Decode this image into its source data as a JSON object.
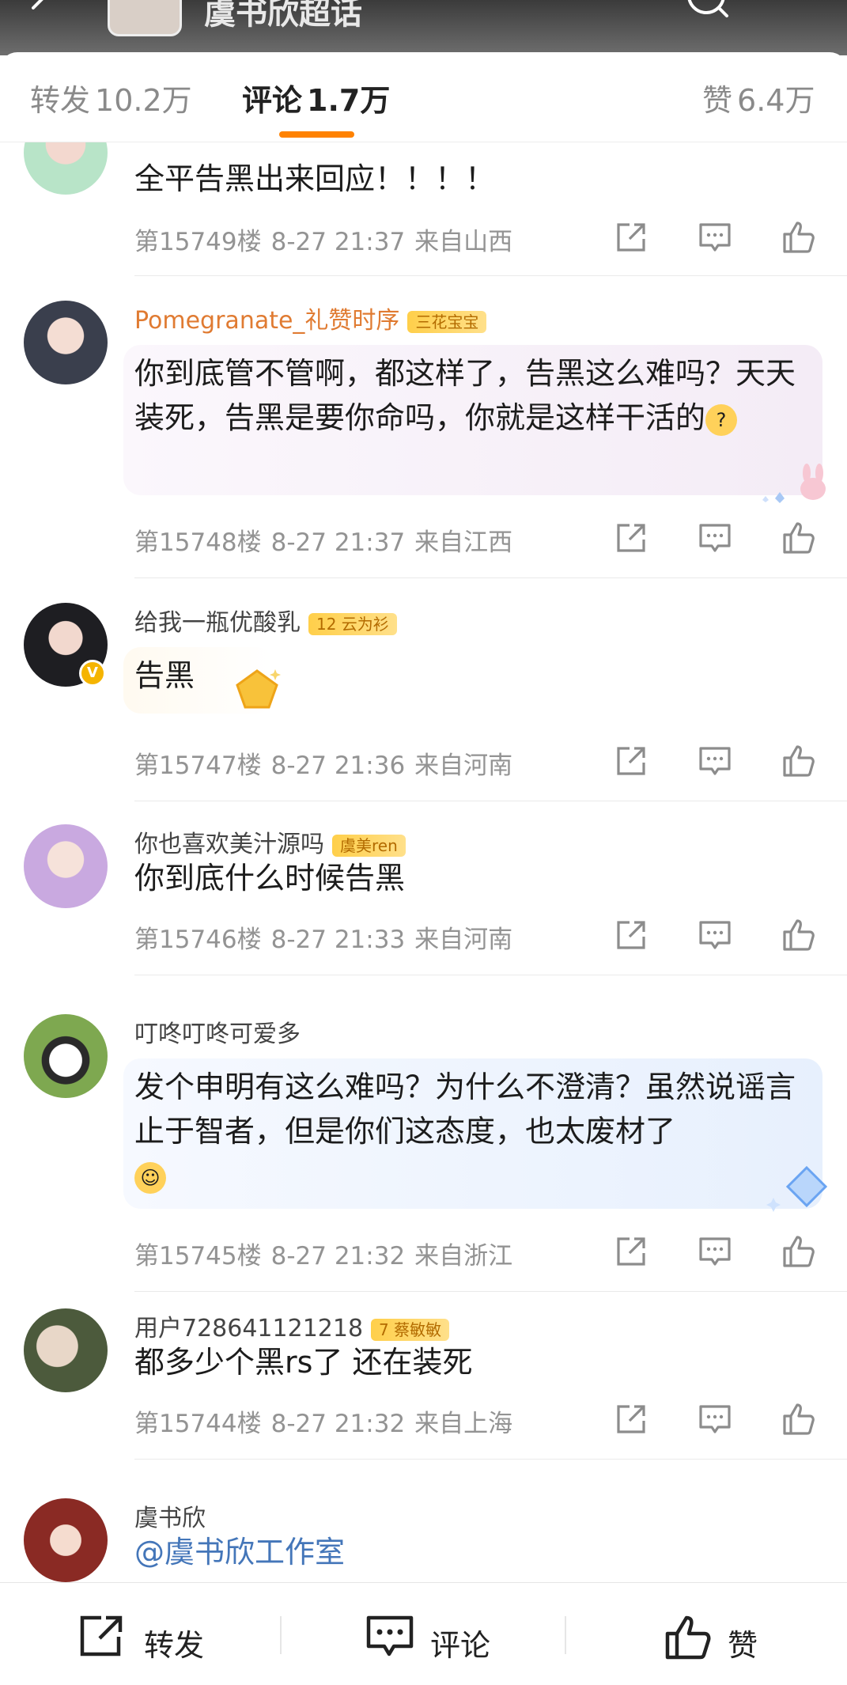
{
  "header": {
    "title": "虞书欣超话"
  },
  "tabs": [
    {
      "label": "转发",
      "count": "10.2万"
    },
    {
      "label": "评论",
      "count": "1.7万"
    },
    {
      "label": "赞",
      "count": "6.4万"
    }
  ],
  "comments": [
    {
      "username": "",
      "text": "全平告黑出来回应！！！！",
      "floor": "第15749楼",
      "time": "8-27 21:37",
      "location": "来自山西"
    },
    {
      "username": "Pomegranate_礼赞时序",
      "tag": "三花宝宝",
      "text": "你到底管不管啊，都这样了，告黑这么难吗？天天装死，告黑是要你命吗，你就是这样干活的",
      "floor": "第15748楼",
      "time": "8-27 21:37",
      "location": "来自江西"
    },
    {
      "username": "给我一瓶优酸乳",
      "tag": "12 云为衫",
      "text": "告黑",
      "floor": "第15747楼",
      "time": "8-27 21:36",
      "location": "来自河南"
    },
    {
      "username": "你也喜欢美汁源吗",
      "tag": "虞美ren",
      "text": "你到底什么时候告黑",
      "floor": "第15746楼",
      "time": "8-27 21:33",
      "location": "来自河南"
    },
    {
      "username": "叮咚叮咚可爱多",
      "tag": "",
      "text": "发个申明有这么难吗？为什么不澄清？虽然说谣言止于智者，但是你们这态度，也太废材了",
      "floor": "第15745楼",
      "time": "8-27 21:32",
      "location": "来自浙江"
    },
    {
      "username": "用户728641121218",
      "tag": "7 蔡敏敏",
      "text": "都多少个黑rs了 还在装死",
      "floor": "第15744楼",
      "time": "8-27 21:32",
      "location": "来自上海"
    },
    {
      "username": "虞书欣",
      "tag": "",
      "text": "@虞书欣工作室",
      "floor": "",
      "time": "",
      "location": ""
    }
  ],
  "bottombar": {
    "repost": "转发",
    "comment": "评论",
    "like": "赞"
  },
  "colors": {
    "accent": "#ff8200",
    "mention": "#4476b9",
    "username": "#e07b32",
    "meta": "#939393"
  }
}
